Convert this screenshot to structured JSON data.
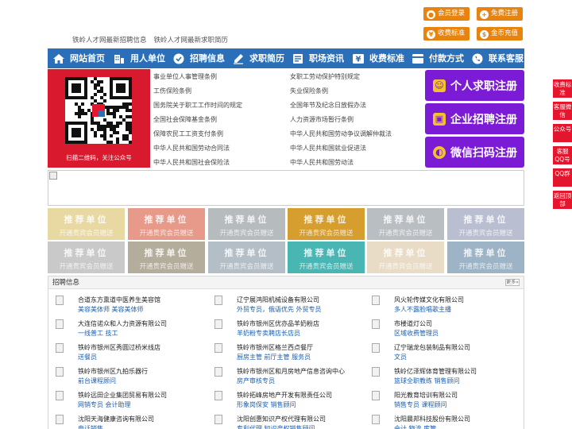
{
  "top_buttons": [
    {
      "label": "会员登录",
      "icon": "user-icon"
    },
    {
      "label": "免费注册",
      "icon": "register-icon"
    },
    {
      "label": "收费标准",
      "icon": "price-icon"
    },
    {
      "label": "金币充值",
      "icon": "coin-icon"
    }
  ],
  "headline": [
    "铁岭人才网最新招聘信息",
    "铁岭人才网最新求职简历"
  ],
  "nav": [
    {
      "label": "网站首页",
      "icon": "home-icon"
    },
    {
      "label": "用人单位",
      "icon": "building-icon"
    },
    {
      "label": "招聘信息",
      "icon": "recruit-icon"
    },
    {
      "label": "求职简历",
      "icon": "resume-icon"
    },
    {
      "label": "职场资讯",
      "icon": "news-icon"
    },
    {
      "label": "收费标准",
      "icon": "price-icon"
    },
    {
      "label": "付款方式",
      "icon": "payment-icon"
    },
    {
      "label": "联系客服",
      "icon": "phone-icon"
    }
  ],
  "qr_caption": "扫描二维码，关注公众号",
  "laws": {
    "left": [
      "事业单位人事管理条例",
      "工伤保险条例",
      "国务院关于职工工作时间的规定",
      "全国社会保障基金条例",
      "保障农民工工资支付条例",
      "中华人民共和国劳动合同法",
      "中华人民共和国社会保险法"
    ],
    "right": [
      "女职工劳动保护特别规定",
      "失业保险条例",
      "全国年节及纪念日放假办法",
      "人力资源市场暂行条例",
      "中华人民共和国劳动争议调解仲裁法",
      "中华人民共和国就业促进法",
      "中华人民共和国劳动法"
    ]
  },
  "register_buttons": [
    {
      "label": "个人求职注册",
      "icon": "person-icon"
    },
    {
      "label": "企业招聘注册",
      "icon": "company-icon"
    },
    {
      "label": "微信扫码注册",
      "icon": "wechat-icon"
    }
  ],
  "recommend": {
    "title": "推荐单位",
    "subtitle": "开通贵宾会员赠送",
    "colors": [
      "#e8d9a3",
      "#e79a8a",
      "#b6bbbe",
      "#d69d2f",
      "#b9bec3",
      "#b9bfd0",
      "#c9c9c9",
      "#b5ad9c",
      "#b4bec6",
      "#49b6b3",
      "#e9dcc6",
      "#9db3c6"
    ]
  },
  "jobs": {
    "title": "招聘信息",
    "more": "更多»",
    "items": [
      {
        "company": "合道东方熏道中医养生美容馆",
        "positions": "美容美体师 美容美体师"
      },
      {
        "company": "辽宁展鸿阳机械设备有限公司",
        "positions": "外贸专员，俄语优先 外贸专员"
      },
      {
        "company": "风火轮传媒文化有限公司",
        "positions": "多人不露脸唱歌主播"
      },
      {
        "company": "大连信诺众和人力资源有限公司",
        "positions": "一线普工 技工"
      },
      {
        "company": "铁岭市银州区优亦品羊奶粉店",
        "positions": "羊奶粉专卖聘店长店员"
      },
      {
        "company": "市楼道灯公司",
        "positions": "区域收费管理员"
      },
      {
        "company": "铁岭市银州区秀圆过桥米线店",
        "positions": "送餐员"
      },
      {
        "company": "铁岭市银州区格兰西点餐厅",
        "positions": "厨房主管 前厅主管 服务员"
      },
      {
        "company": "辽宁瑞龙包装制品有限公司",
        "positions": "文员"
      },
      {
        "company": "铁岭市银州区九拍乐器行",
        "positions": "前台课程顾问"
      },
      {
        "company": "铁岭市银州区和月房地产信息咨询中心",
        "positions": "房产审核专员"
      },
      {
        "company": "铁岭亿泽辉体育管理有限公司",
        "positions": "篮球全职教练 销售顾问"
      },
      {
        "company": "铁岭远田企业集团贸易有限公司",
        "positions": "网销专员 会计助理"
      },
      {
        "company": "铁岭拓峰房地产开发有限责任公司",
        "positions": "形象岗保安 销售顾问"
      },
      {
        "company": "阳光教育培训有限公司",
        "positions": "销售专员 课程顾问"
      },
      {
        "company": "沈阳天海健康咨询有限公司",
        "positions": "电话销售"
      },
      {
        "company": "沈阳创惠知识产权代理有限公司",
        "positions": "专利代理 知识产权销售顾问"
      },
      {
        "company": "沈阳晨邦科技股份有限公司",
        "positions": "会计 物流 库管"
      }
    ]
  },
  "side_buttons": [
    "收费标准",
    "客服微信",
    "公众号",
    "客服QQ号",
    "QQ群",
    "返回顶部"
  ]
}
